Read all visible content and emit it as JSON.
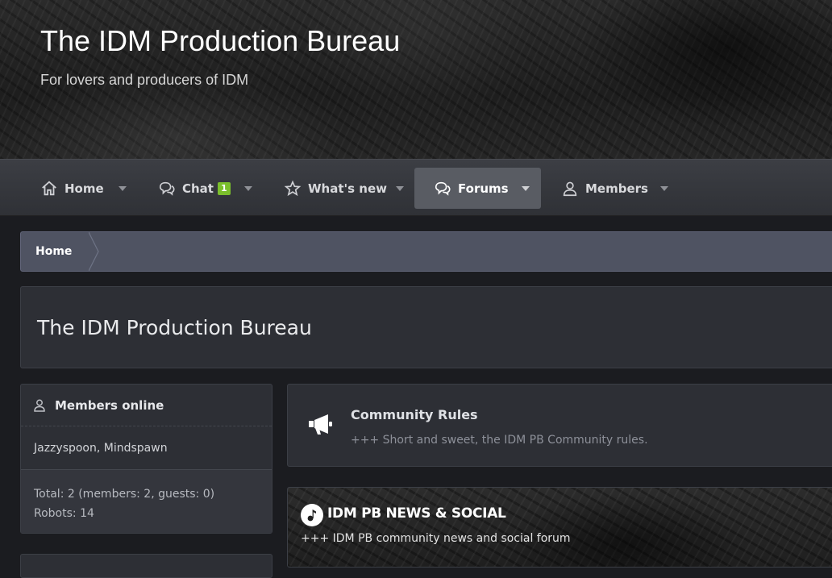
{
  "header": {
    "title": "The IDM Production Bureau",
    "tagline": "For lovers and producers of IDM"
  },
  "nav": {
    "tabs": [
      {
        "label": "Home",
        "icon": "home-icon"
      },
      {
        "label": "Chat",
        "icon": "chat-icon",
        "badge": "1"
      },
      {
        "label": "What's new",
        "icon": "star-icon"
      },
      {
        "label": "Forums",
        "icon": "chat-icon",
        "active": true
      },
      {
        "label": "Members",
        "icon": "user-icon"
      }
    ]
  },
  "breadcrumb": {
    "items": [
      "Home"
    ]
  },
  "page": {
    "title": "The IDM Production Bureau"
  },
  "sidebar": {
    "members_online": {
      "heading": "Members online",
      "users": "Jazzyspoon, Mindspawn",
      "total": "Total: 2 (members: 2, guests: 0)",
      "robots": "Robots: 14"
    }
  },
  "forums": {
    "rules": {
      "title": "Community Rules",
      "description": "+++ Short and sweet, the IDM PB Community rules.",
      "icon": "megaphone-icon"
    },
    "category": {
      "title": "IDM PB NEWS & SOCIAL",
      "description": "+++ IDM PB community news and social forum",
      "icon": "music-note-icon"
    }
  },
  "colors": {
    "accent_badge": "#7bbf2c",
    "breadcrumb_bg": "#4f5362",
    "block_bg": "#2d2f35",
    "page_bg": "#1b1c20"
  }
}
